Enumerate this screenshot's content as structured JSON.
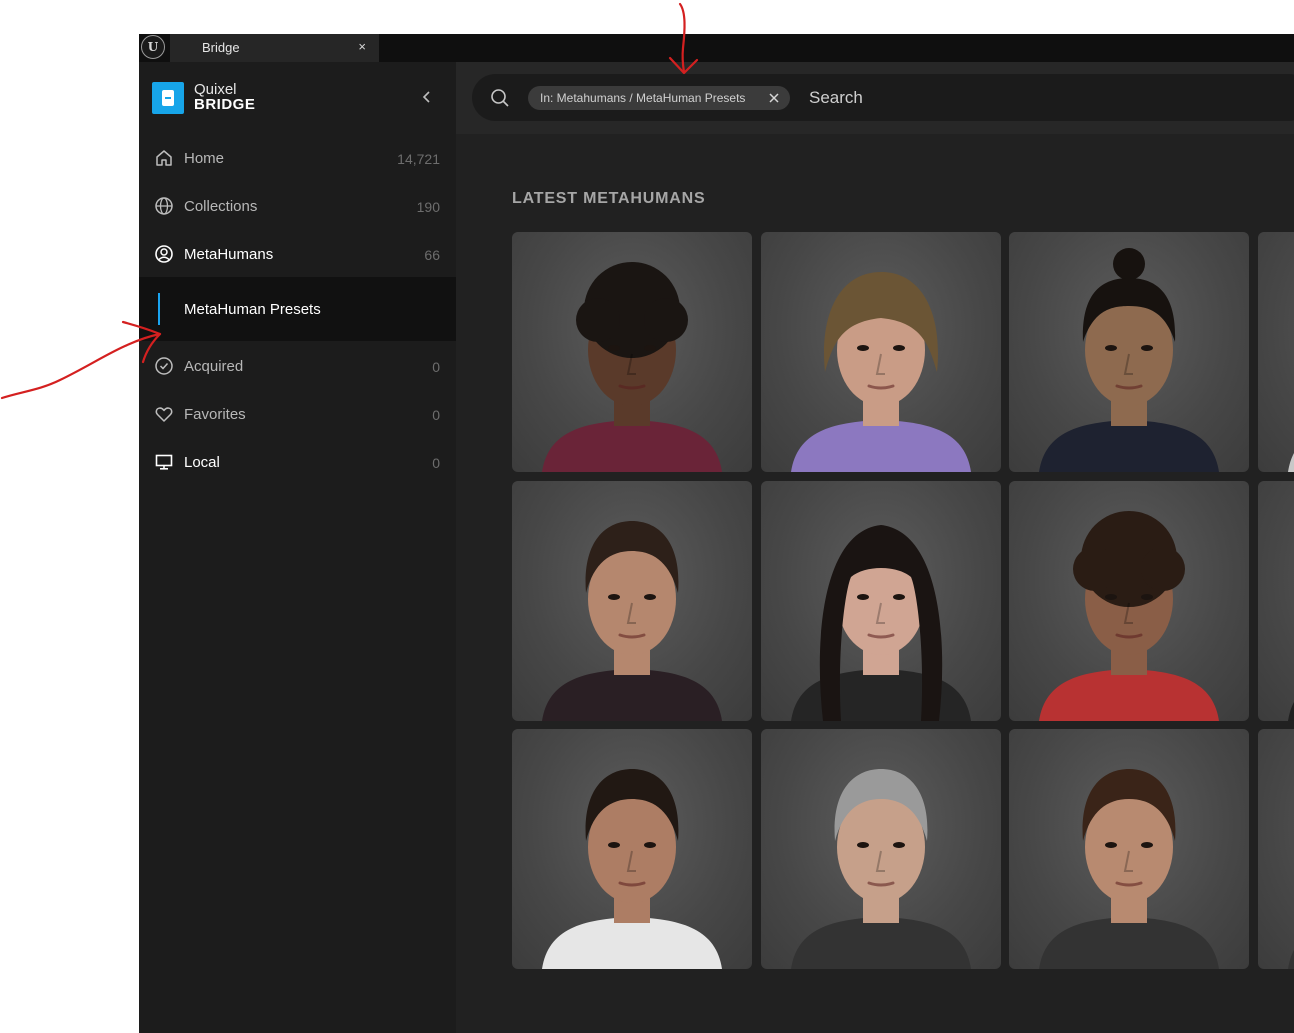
{
  "window": {
    "tab_title": "Bridge",
    "tab_close": "×"
  },
  "brand": {
    "line1": "Quixel",
    "line2": "BRIDGE"
  },
  "nav": {
    "home": {
      "label": "Home",
      "count": "14,721"
    },
    "collections": {
      "label": "Collections",
      "count": "190"
    },
    "metahumans": {
      "label": "MetaHumans",
      "count": "66"
    },
    "presets": {
      "label": "MetaHuman Presets"
    },
    "acquired": {
      "label": "Acquired",
      "count": "0"
    },
    "favorites": {
      "label": "Favorites",
      "count": "0"
    },
    "local": {
      "label": "Local",
      "count": "0"
    }
  },
  "search": {
    "filter_chip": "In: Metahumans / MetaHuman Presets",
    "placeholder": "Search"
  },
  "section": {
    "title": "LATEST METAHUMANS"
  },
  "cards": [
    {
      "hair": "#1a1512",
      "skin": "#5a3a2a",
      "shirt": "#6a2438",
      "style": "curly"
    },
    {
      "hair": "#6b5535",
      "skin": "#c99c86",
      "shirt": "#8c78c0",
      "style": "bob"
    },
    {
      "hair": "#17120f",
      "skin": "#8e6a4f",
      "shirt": "#1e2230",
      "style": "bun"
    },
    {
      "hair": "#120e0c",
      "skin": "#7a5540",
      "shirt": "#c8c8c8",
      "style": "long"
    },
    {
      "hair": "#2d2019",
      "skin": "#b5876e",
      "shirt": "#2a1f24",
      "style": "short"
    },
    {
      "hair": "#1a1412",
      "skin": "#d0a593",
      "shirt": "#252525",
      "style": "long"
    },
    {
      "hair": "#2a1c14",
      "skin": "#8a5e47",
      "shirt": "#b83232",
      "style": "curly"
    },
    {
      "hair": "#3a2a20",
      "skin": "#b98a70",
      "shirt": "#202020",
      "style": "short"
    },
    {
      "hair": "#211813",
      "skin": "#ad7d64",
      "shirt": "#e6e6e6",
      "style": "short"
    },
    {
      "hair": "#9a9a9a",
      "skin": "#c6a08a",
      "shirt": "#333333",
      "style": "short"
    },
    {
      "hair": "#3a2418",
      "skin": "#b88a70",
      "shirt": "#333333",
      "style": "short"
    },
    {
      "hair": "#141010",
      "skin": "#6f4a38",
      "shirt": "#333333",
      "style": "bun"
    }
  ],
  "colors": {
    "accent": "#1aa4f0",
    "brand": "#17a5e9",
    "annotation": "#d42020"
  }
}
